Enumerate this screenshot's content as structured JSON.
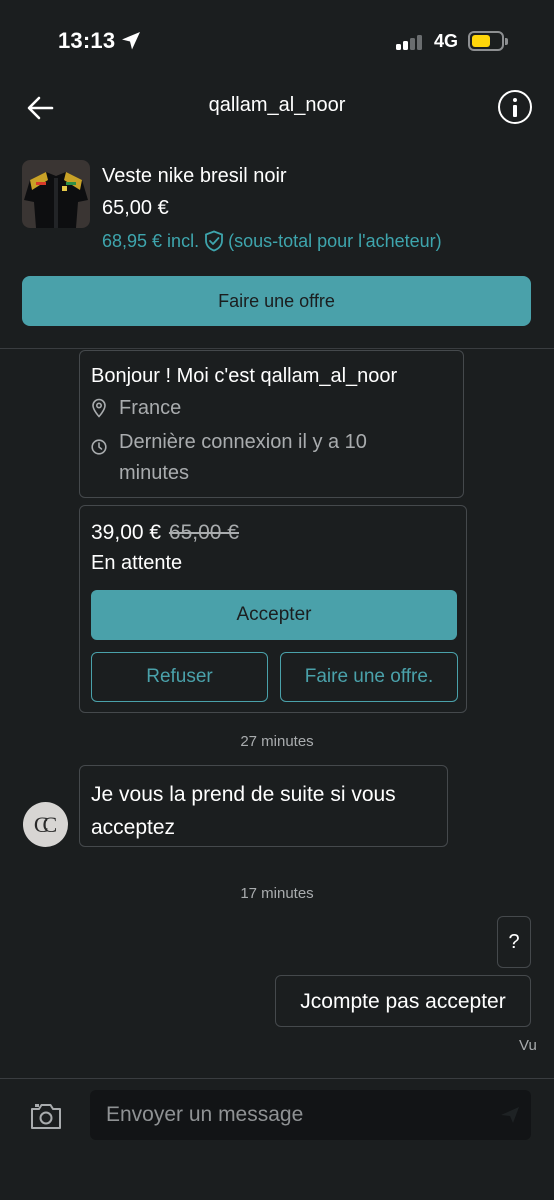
{
  "status_bar": {
    "time": "13:13",
    "network": "4G",
    "battery_color": "#ffd60a"
  },
  "header": {
    "title": "qallam_al_noor",
    "back_icon": "arrow-left-icon",
    "info_icon": "info-circle-icon"
  },
  "item": {
    "title": "Veste nike bresil noir",
    "price": "65,00 €",
    "incl_price": "68,95 € incl.",
    "incl_note": "(sous-total pour l'acheteur)",
    "shield_icon": "shield-check-icon",
    "make_offer_label": "Faire une offre"
  },
  "conversation": {
    "intro_title": "Bonjour ! Moi c'est qallam_al_noor",
    "location": "France",
    "last_seen_line1": "Dernière connexion il y a 10",
    "last_seen_line2": "minutes",
    "offer": {
      "new_price": "39,00 €",
      "old_price": "65,00 €",
      "status": "En attente",
      "accept_label": "Accepter",
      "refuse_label": "Refuser",
      "counter_label": "Faire une offre."
    },
    "time_1": "27 minutes",
    "received_message_line1": "Je vous la prend de suite si vous",
    "received_message_line2": "acceptez",
    "time_2": "17 minutes",
    "sent_message_1": "?",
    "sent_message_2": "Jcompte pas accepter",
    "seen_label": "Vu"
  },
  "composer": {
    "placeholder": "Envoyer un message",
    "camera_icon": "camera-icon"
  },
  "colors": {
    "accent": "#4aa1aa",
    "background": "#1b1e1f",
    "bubble_border": "#45494c",
    "muted_text": "#a9acae"
  }
}
